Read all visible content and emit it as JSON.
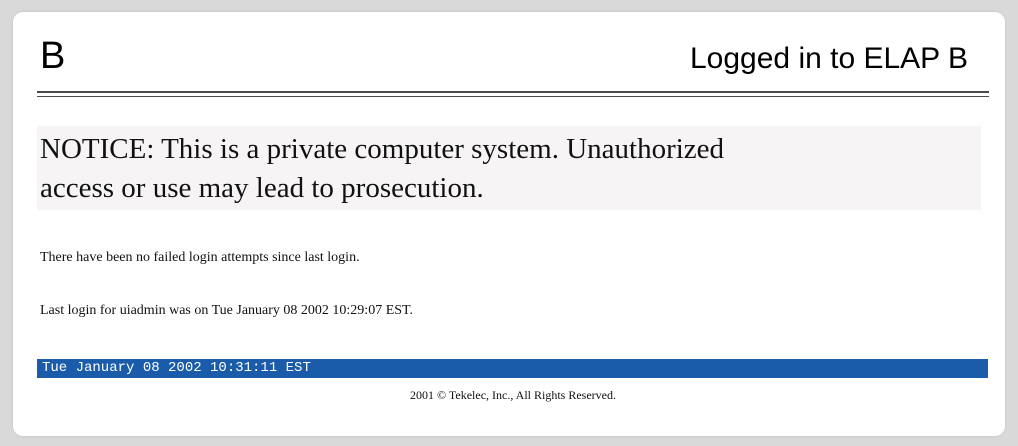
{
  "header": {
    "server_letter": "B",
    "login_status": "Logged in to ELAP B"
  },
  "notice": {
    "line1": "NOTICE: This is a private computer system. Unauthorized",
    "line2": "access or use may lead to prosecution."
  },
  "messages": {
    "failed_logins": "There have been no failed login attempts since last login.",
    "last_login": "Last login for uiadmin was on Tue January 08 2002 10:29:07 EST."
  },
  "status_bar": {
    "datetime": "Tue January 08 2002 10:31:11 EST"
  },
  "footer": {
    "copyright": "2001 © Tekelec, Inc., All Rights Reserved."
  },
  "colors": {
    "status_bar_background": "#1a5ca9",
    "notice_background": "#f7f4f5"
  }
}
